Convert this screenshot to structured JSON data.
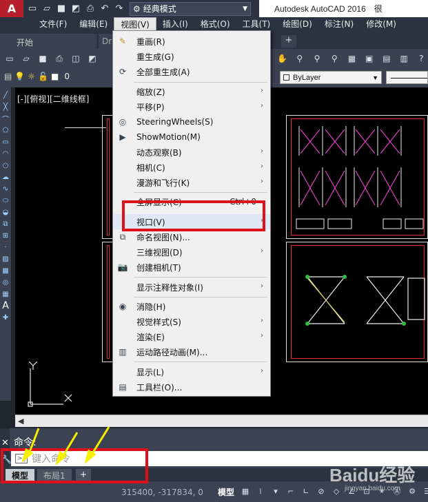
{
  "app": {
    "title": "Autodesk AutoCAD 2016",
    "title_suffix": "很",
    "logo_letter": "A",
    "workspace": "经典模式"
  },
  "menubar": {
    "items": [
      "文件(F)",
      "编辑(E)",
      "视图(V)",
      "插入(I)",
      "格式(O)",
      "工具(T)",
      "绘图(D)",
      "标注(N)",
      "修改(M)"
    ],
    "active_index": 2
  },
  "doc_tabs": {
    "start": "开始",
    "drawing": "Dr",
    "add": "+"
  },
  "layer_toolbar": {
    "layer_name": "0",
    "bylayer": "ByLayer"
  },
  "viewport_label": "[-][俯视][二维线框]",
  "view_menu": {
    "items": [
      {
        "label": "重画(R)",
        "icon": "pencil-icon",
        "submenu": false
      },
      {
        "label": "重生成(G)",
        "icon": "",
        "submenu": false
      },
      {
        "label": "全部重生成(A)",
        "icon": "regen-all-icon",
        "submenu": false
      },
      {
        "label": "缩放(Z)",
        "icon": "",
        "submenu": true
      },
      {
        "label": "平移(P)",
        "icon": "",
        "submenu": true
      },
      {
        "label": "SteeringWheels(S)",
        "icon": "steering-wheel-icon",
        "submenu": false
      },
      {
        "label": "ShowMotion(M)",
        "icon": "showmotion-icon",
        "submenu": false
      },
      {
        "label": "动态观察(B)",
        "icon": "",
        "submenu": true
      },
      {
        "label": "相机(C)",
        "icon": "",
        "submenu": true
      },
      {
        "label": "漫游和飞行(K)",
        "icon": "",
        "submenu": true
      },
      {
        "label": "全屏显示(C)",
        "icon": "",
        "submenu": false,
        "shortcut": "Ctrl+0"
      },
      {
        "label": "视口(V)",
        "icon": "",
        "submenu": true
      },
      {
        "label": "命名视图(N)...",
        "icon": "named-view-icon",
        "submenu": false
      },
      {
        "label": "三维视图(D)",
        "icon": "",
        "submenu": true
      },
      {
        "label": "创建相机(T)",
        "icon": "camera-icon",
        "submenu": false
      },
      {
        "label": "显示注释性对象(I)",
        "icon": "",
        "submenu": true
      },
      {
        "label": "消隐(H)",
        "icon": "hide-icon",
        "submenu": false
      },
      {
        "label": "视觉样式(S)",
        "icon": "",
        "submenu": true
      },
      {
        "label": "渲染(E)",
        "icon": "",
        "submenu": true
      },
      {
        "label": "运动路径动画(M)...",
        "icon": "motion-path-icon",
        "submenu": false
      },
      {
        "label": "显示(L)",
        "icon": "",
        "submenu": true
      },
      {
        "label": "工具栏(O)...",
        "icon": "toolbar-icon",
        "submenu": false
      }
    ]
  },
  "command": {
    "history_label": "命令:",
    "input_placeholder": "键入命令"
  },
  "layout_tabs": {
    "model": "模型",
    "layout1": "布局1",
    "add": "+"
  },
  "status": {
    "coords": "315400, -317834, 0",
    "model": "模型"
  },
  "watermark": {
    "main": "Baidu经验",
    "sub": "jingyan.baidu.com"
  },
  "colors": {
    "highlight": "#e0101a",
    "arrows": "#f5f000",
    "app_red": "#b7202a"
  }
}
